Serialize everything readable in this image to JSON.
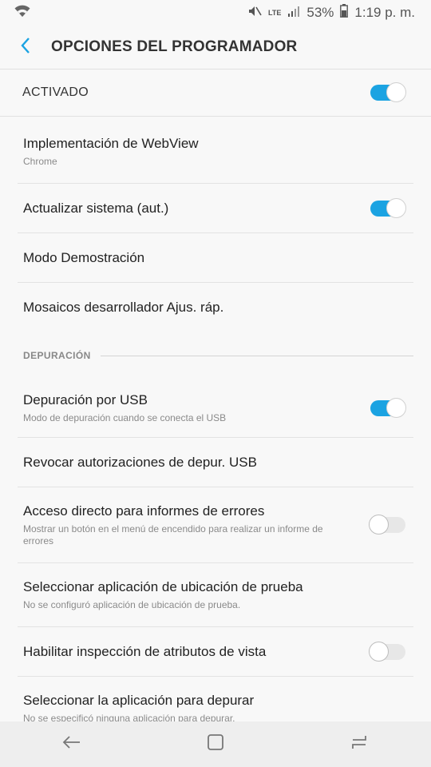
{
  "status_bar": {
    "wifi_icon": "wifi-icon",
    "mute_icon": "vibrate-mute-icon",
    "network_label": "LTE",
    "signal_icon": "signal-icon",
    "battery_percent": "53%",
    "battery_icon": "battery-icon",
    "time": "1:19 p. m."
  },
  "app_bar": {
    "back_icon": "back-arrow-icon",
    "title": "OPCIONES DEL PROGRAMADOR"
  },
  "master_switch": {
    "label": "ACTIVADO",
    "enabled": true
  },
  "items_top": [
    {
      "title": "Implementación de WebView",
      "subtitle": "Chrome",
      "toggle": null
    },
    {
      "title": "Actualizar sistema (aut.)",
      "subtitle": "",
      "toggle": true
    },
    {
      "title": "Modo Demostración",
      "subtitle": "",
      "toggle": null
    },
    {
      "title": "Mosaicos desarrollador Ajus. ráp.",
      "subtitle": "",
      "toggle": null
    }
  ],
  "section": {
    "label": "DEPURACIÓN"
  },
  "items_debug": [
    {
      "title": "Depuración por USB",
      "subtitle": "Modo de depuración cuando se conecta el USB",
      "toggle": true
    },
    {
      "title": "Revocar autorizaciones de depur. USB",
      "subtitle": "",
      "toggle": null
    },
    {
      "title": "Acceso directo para informes de errores",
      "subtitle": "Mostrar un botón en el menú de encendido para realizar un informe de errores",
      "toggle": false
    },
    {
      "title": "Seleccionar aplicación de ubicación de prueba",
      "subtitle": "No se configuró aplicación de ubicación de prueba.",
      "toggle": null
    },
    {
      "title": "Habilitar inspección de atributos de vista",
      "subtitle": "",
      "toggle": false
    },
    {
      "title": "Seleccionar la aplicación para depurar",
      "subtitle": "No se especificó ninguna aplicación para depurar.",
      "toggle": null
    }
  ],
  "nav_bar": {
    "back_icon": "nav-back-icon",
    "home_icon": "nav-home-icon",
    "recents_icon": "nav-recents-icon"
  },
  "colors": {
    "accent": "#1ba3e2",
    "background": "#f8f8f8",
    "navbar": "#eeeeee"
  }
}
